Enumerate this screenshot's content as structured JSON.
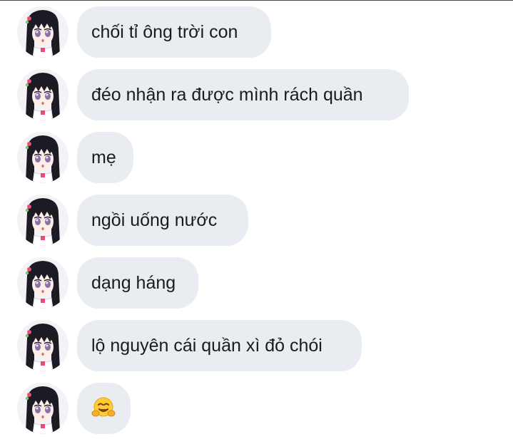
{
  "messages": [
    {
      "text": "chối tỉ ông trời con"
    },
    {
      "text": "đéo nhận ra được mình rách quần"
    },
    {
      "text": "mẹ"
    },
    {
      "text": "ngồi uống nước"
    },
    {
      "text": "dạng háng"
    },
    {
      "text": "lộ nguyên cái quần xì đỏ chói"
    },
    {
      "text": "",
      "emoji": "hugging-face-emoji"
    }
  ],
  "colors": {
    "bubble": "#e9edf2",
    "text": "#1b1b1b",
    "hair": "#1c1a22",
    "skin": "#fbeee6",
    "eyes": "#8a6fa8",
    "accent": "#e84a7a"
  }
}
